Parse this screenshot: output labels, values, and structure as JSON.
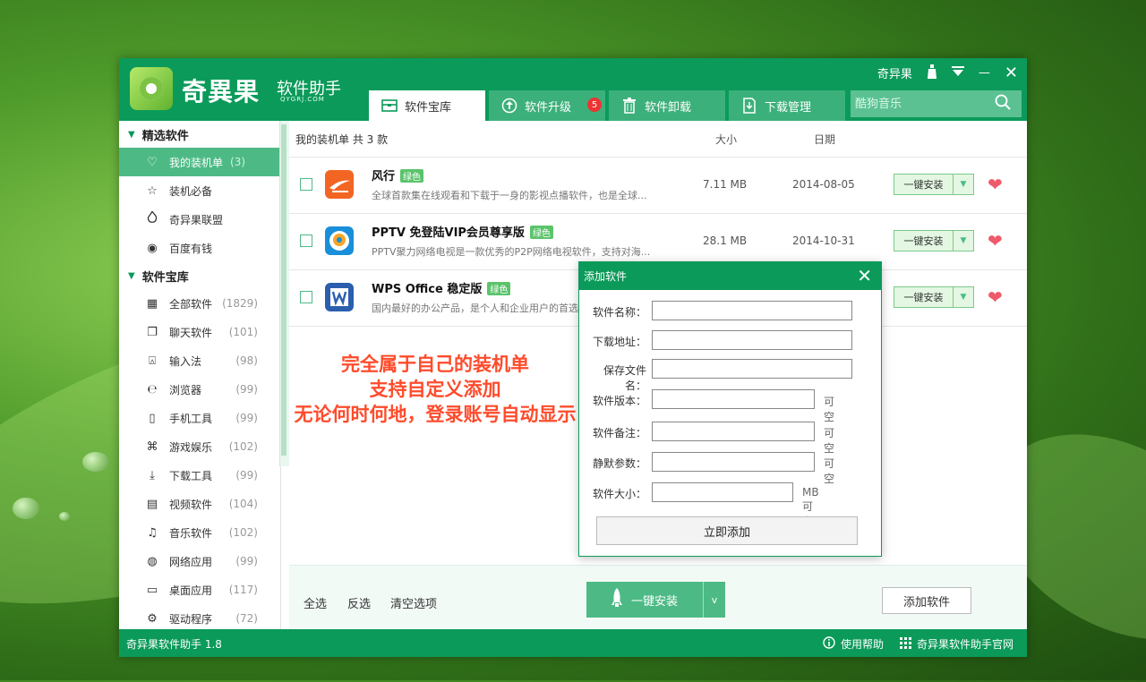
{
  "window": {
    "app_name": "奇異果",
    "app_subtitle": "软件助手",
    "app_url": "QYGRJ.COM",
    "user_label": "奇异果",
    "minimize": "—",
    "close": "✕"
  },
  "tabs": [
    {
      "label": "软件宝库",
      "icon": "treasure-box-icon"
    },
    {
      "label": "软件升级",
      "icon": "upgrade-arrow-icon",
      "badge": "5"
    },
    {
      "label": "软件卸载",
      "icon": "trash-icon"
    },
    {
      "label": "下载管理",
      "icon": "download-icon"
    }
  ],
  "search": {
    "placeholder": "酷狗音乐"
  },
  "sidebar": {
    "section1": "精选软件",
    "section1_items": [
      {
        "label": "我的装机单",
        "count": "(3)",
        "icon": "heart-icon"
      },
      {
        "label": "装机必备",
        "icon": "star-icon"
      },
      {
        "label": "奇异果联盟",
        "icon": "flame-icon"
      },
      {
        "label": "百度有钱",
        "icon": "target-icon"
      }
    ],
    "section2": "软件宝库",
    "section2_items": [
      {
        "label": "全部软件",
        "count": "(1829)",
        "icon": "grid-icon"
      },
      {
        "label": "聊天软件",
        "count": "(101)",
        "icon": "chat-icon"
      },
      {
        "label": "输入法",
        "count": "(98)",
        "icon": "input-icon"
      },
      {
        "label": "浏览器",
        "count": "(99)",
        "icon": "browser-icon"
      },
      {
        "label": "手机工具",
        "count": "(99)",
        "icon": "phone-icon"
      },
      {
        "label": "游戏娱乐",
        "count": "(102)",
        "icon": "gamepad-icon"
      },
      {
        "label": "下载工具",
        "count": "(99)",
        "icon": "download-icon"
      },
      {
        "label": "视频软件",
        "count": "(104)",
        "icon": "film-icon"
      },
      {
        "label": "音乐软件",
        "count": "(102)",
        "icon": "music-icon"
      },
      {
        "label": "网络应用",
        "count": "(99)",
        "icon": "globe-icon"
      },
      {
        "label": "桌面应用",
        "count": "(117)",
        "icon": "monitor-icon"
      },
      {
        "label": "驱动程序",
        "count": "(72)",
        "icon": "gear-icon"
      }
    ]
  },
  "list": {
    "title": "我的装机单 共 3 款",
    "col_size": "大小",
    "col_date": "日期",
    "rows": [
      {
        "name": "风行",
        "tag": "绿色",
        "desc": "全球首款集在线观看和下载于一身的影视点播软件，也是全球...",
        "size": "7.11 MB",
        "date": "2014-08-05",
        "install": "一键安装",
        "icon_color": "#f26522"
      },
      {
        "name": "PPTV 免登陆VIP会员尊享版",
        "tag": "绿色",
        "desc": "PPTV聚力网络电视是一款优秀的P2P网络电视软件，支持对海...",
        "size": "28.1 MB",
        "date": "2014-10-31",
        "install": "一键安装",
        "icon_color": "#1a8fd9"
      },
      {
        "name": "WPS Office 稳定版",
        "tag": "绿色",
        "desc": "国内最好的办公产品，是个人和企业用户的首选",
        "size": "",
        "date": "",
        "install": "一键安装",
        "icon_color": "#2b5fad"
      }
    ]
  },
  "promo": {
    "line1": "完全属于自己的装机单",
    "line2": "支持自定义添加",
    "line3": "无论何时何地，登录账号自动显示"
  },
  "bottom": {
    "select_all": "全选",
    "invert": "反选",
    "clear": "清空选项",
    "install_all": "一键安装",
    "install_arrow": "v",
    "add_software": "添加软件"
  },
  "status": {
    "version": "奇异果软件助手 1.8",
    "help": "使用帮助",
    "site": "奇异果软件助手官网"
  },
  "dialog": {
    "title": "添加软件",
    "fields": [
      {
        "label": "软件名称：",
        "note": ""
      },
      {
        "label": "下载地址：",
        "note": ""
      },
      {
        "label": "保存文件名：",
        "note": ""
      },
      {
        "label": "软件版本：",
        "note": "可空"
      },
      {
        "label": "软件备注：",
        "note": "可空"
      },
      {
        "label": "静默参数：",
        "note": "可空"
      },
      {
        "label": "软件大小：",
        "note": "MB 可空"
      }
    ],
    "submit": "立即添加"
  },
  "colors": {
    "brand": "#0b9a5a",
    "accent": "#4dba86",
    "promo": "#ff4b2b"
  }
}
